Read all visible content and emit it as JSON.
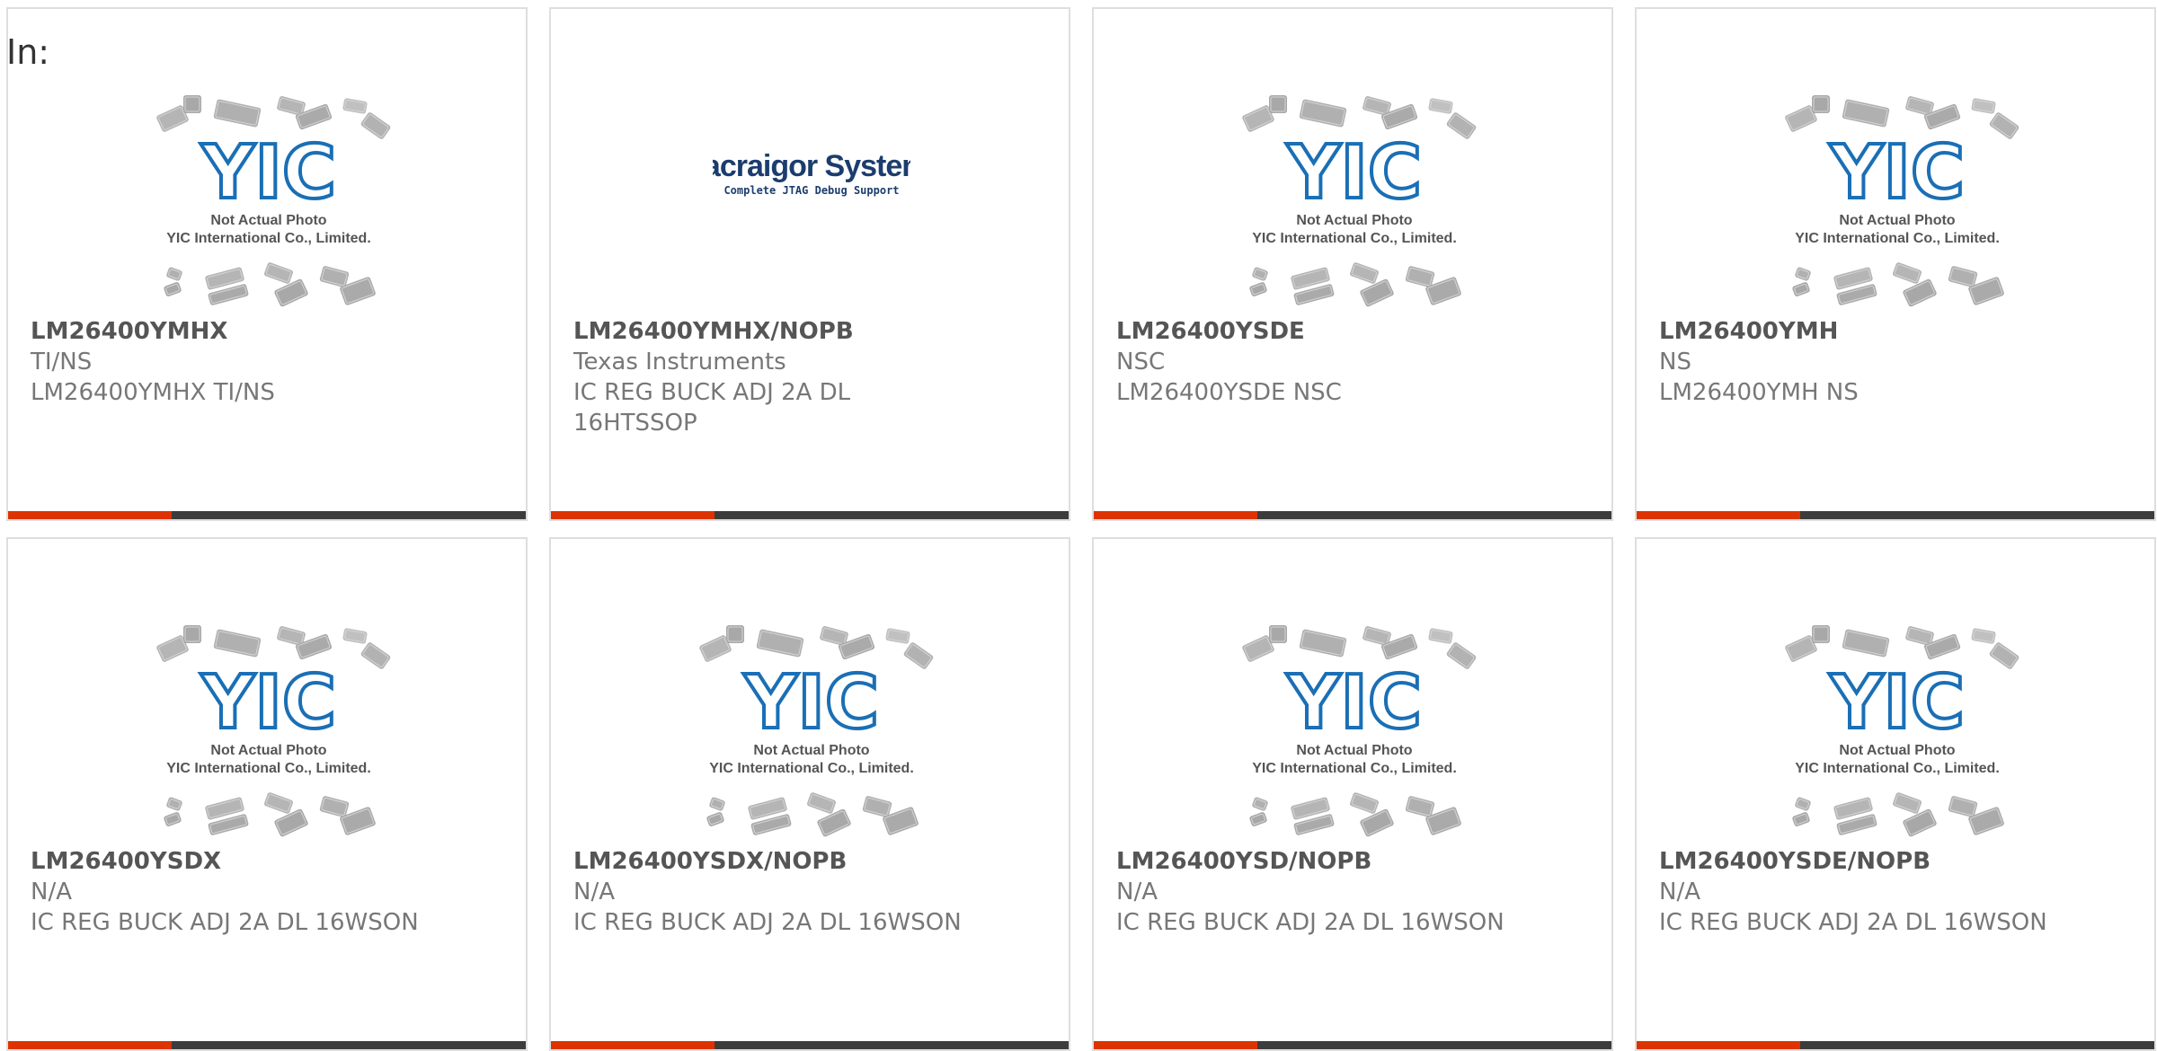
{
  "header": {
    "in_label": "In:"
  },
  "products": [
    {
      "part_number": "LM26400YMHX",
      "manufacturer": "TI/NS",
      "description": "LM26400YMHX TI/NS",
      "image": "yic-placeholder"
    },
    {
      "part_number": "LM26400YMHX/NOPB",
      "manufacturer": "Texas Instruments",
      "description": "IC REG BUCK ADJ 2A DL 16HTSSOP",
      "image": "macraigor-logo"
    },
    {
      "part_number": "LM26400YSDE",
      "manufacturer": "NSC",
      "description": "LM26400YSDE NSC",
      "image": "yic-placeholder"
    },
    {
      "part_number": "LM26400YMH",
      "manufacturer": "NS",
      "description": "LM26400YMH NS",
      "image": "yic-placeholder"
    },
    {
      "part_number": "LM26400YSDX",
      "manufacturer": "N/A",
      "description": "IC REG BUCK ADJ 2A DL 16WSON",
      "image": "yic-placeholder"
    },
    {
      "part_number": "LM26400YSDX/NOPB",
      "manufacturer": "N/A",
      "description": "IC REG BUCK ADJ 2A DL 16WSON",
      "image": "yic-placeholder"
    },
    {
      "part_number": "LM26400YSD/NOPB",
      "manufacturer": "N/A",
      "description": "IC REG BUCK ADJ 2A DL 16WSON",
      "image": "yic-placeholder"
    },
    {
      "part_number": "LM26400YSDE/NOPB",
      "manufacturer": "N/A",
      "description": "IC REG BUCK ADJ 2A DL 16WSON",
      "image": "yic-placeholder"
    }
  ],
  "placeholder_image": {
    "logo_text": "YIC",
    "caption_line1": "Not Actual Photo",
    "caption_line2": "YIC International Co., Limited."
  },
  "brand_logo": {
    "name": "Macraigor Systems",
    "tagline": "Complete JTAG Debug Support"
  },
  "colors": {
    "accent": "#dd3300",
    "bar": "#3c3c3c",
    "logo_blue": "#1a6fb5",
    "text": "#777777"
  }
}
